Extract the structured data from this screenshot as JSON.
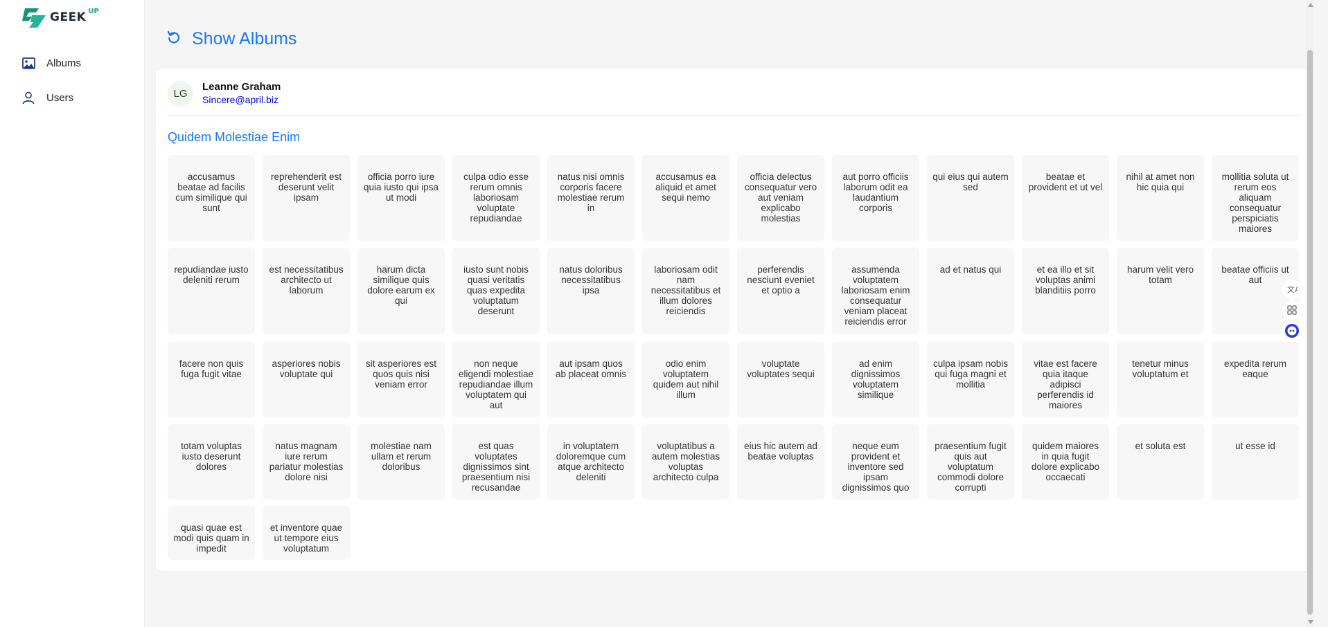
{
  "brand": {
    "name": "GEEK",
    "sup": "UP"
  },
  "sidebar": {
    "items": [
      {
        "label": "Albums",
        "icon": "image-icon"
      },
      {
        "label": "Users",
        "icon": "user-icon"
      }
    ]
  },
  "header": {
    "title": "Show Albums",
    "icon": "reload-icon"
  },
  "user": {
    "initials": "LG",
    "name": "Leanne Graham",
    "email": "Sincere@april.biz"
  },
  "album": {
    "title": "Quidem Molestiae Enim"
  },
  "photos": [
    "accusamus beatae ad facilis cum similique qui sunt",
    "reprehenderit est deserunt velit ipsam",
    "officia porro iure quia iusto qui ipsa ut modi",
    "culpa odio esse rerum omnis laboriosam voluptate repudiandae",
    "natus nisi omnis corporis facere molestiae rerum in",
    "accusamus ea aliquid et amet sequi nemo",
    "officia delectus consequatur vero aut veniam explicabo molestias",
    "aut porro officiis laborum odit ea laudantium corporis",
    "qui eius qui autem sed",
    "beatae et provident et ut vel",
    "nihil at amet non hic quia qui",
    "mollitia soluta ut rerum eos aliquam consequatur perspiciatis maiores",
    "repudiandae iusto deleniti rerum",
    "est necessitatibus architecto ut laborum",
    "harum dicta similique quis dolore earum ex qui",
    "iusto sunt nobis quasi veritatis quas expedita voluptatum deserunt",
    "natus doloribus necessitatibus ipsa",
    "laboriosam odit nam necessitatibus et illum dolores reiciendis",
    "perferendis nesciunt eveniet et optio a",
    "assumenda voluptatem laboriosam enim consequatur veniam placeat reiciendis error",
    "ad et natus qui",
    "et ea illo et sit voluptas animi blanditiis porro",
    "harum velit vero totam",
    "beatae officiis ut aut",
    "facere non quis fuga fugit vitae",
    "asperiores nobis voluptate qui",
    "sit asperiores est quos quis nisi veniam error",
    "non neque eligendi molestiae repudiandae illum voluptatem qui aut",
    "aut ipsam quos ab placeat omnis",
    "odio enim voluptatem quidem aut nihil illum",
    "voluptate voluptates sequi",
    "ad enim dignissimos voluptatem similique",
    "culpa ipsam nobis qui fuga magni et mollitia",
    "vitae est facere quia itaque adipisci perferendis id maiores",
    "tenetur minus voluptatum et",
    "expedita rerum eaque",
    "totam voluptas iusto deserunt dolores",
    "natus magnam iure rerum pariatur molestias dolore nisi",
    "molestiae nam ullam et rerum doloribus",
    "est quas voluptates dignissimos sint praesentium nisi recusandae",
    "in voluptatem doloremque cum atque architecto deleniti",
    "voluptatibus a autem molestias voluptas architecto culpa",
    "eius hic autem ad beatae voluptas",
    "neque eum provident et inventore sed ipsam dignissimos quo",
    "praesentium fugit quis aut voluptatum commodi dolore corrupti",
    "quidem maiores in quia fugit dolore explicabo occaecati",
    "et soluta est",
    "ut esse id",
    "quasi quae est modi quis quam in impedit",
    "et inventore quae ut tempore eius voluptatum"
  ],
  "colors": {
    "accent": "#1677ff",
    "brand_green": "#14a58a"
  }
}
